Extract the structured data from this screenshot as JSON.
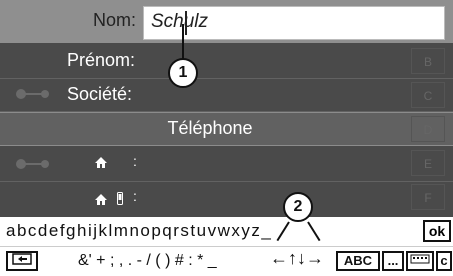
{
  "form": {
    "nom_label": "Nom:",
    "nom_value": "Schulz",
    "prenom_label": "Prénom:",
    "societe_label": "Société:",
    "telephone_header": "Téléphone",
    "home_phone_colon": ":",
    "home_mobile_colon": ":"
  },
  "index_letters": [
    "B",
    "C",
    "D",
    "E",
    "F"
  ],
  "callouts": {
    "one": "1",
    "two": "2"
  },
  "keyboard": {
    "letters": "abcdefghijklmnopqrstuvwxyz_",
    "ok": "ok",
    "symbols": "&' + ; , . - / ( ) # : * _",
    "abc": "ABC",
    "ellipsis": "...",
    "c": "c"
  },
  "icons": {
    "contact_icon": "contact-icon",
    "home_icon": "home-icon",
    "mobile_icon": "mobile-icon",
    "back_icon": "back-icon",
    "arrow_left_icon": "arrow-left-icon",
    "arrow_up_icon": "arrow-up-icon",
    "arrow_down_icon": "arrow-down-icon",
    "arrow_right_icon": "arrow-right-icon",
    "keyboard_layout_icon": "keyboard-layout-icon"
  }
}
